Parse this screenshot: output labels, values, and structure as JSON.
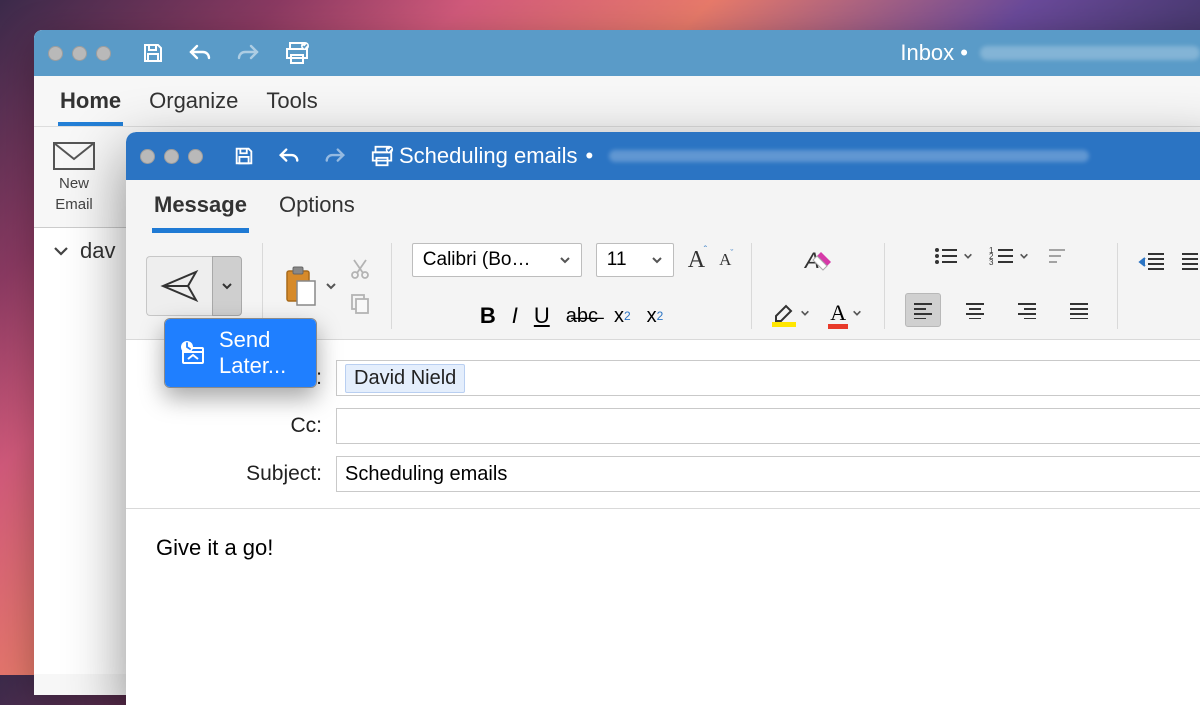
{
  "back_window": {
    "title": "Inbox",
    "tabs": [
      "Home",
      "Organize",
      "Tools"
    ],
    "active_tab": 0,
    "new_email_lines": [
      "New",
      "Email"
    ],
    "folder_row": "dav"
  },
  "compose": {
    "title": "Scheduling emails",
    "tabs": [
      "Message",
      "Options"
    ],
    "active_tab": 0,
    "menu": {
      "send_later": "Send Later..."
    },
    "font": {
      "name": "Calibri (Bo…",
      "size": "11"
    },
    "fields": {
      "to_label": "To:",
      "to_value": "David Nield",
      "cc_label": "Cc:",
      "cc_value": "",
      "subject_label": "Subject:",
      "subject_value": "Scheduling emails"
    },
    "body": "Give it a go!"
  }
}
